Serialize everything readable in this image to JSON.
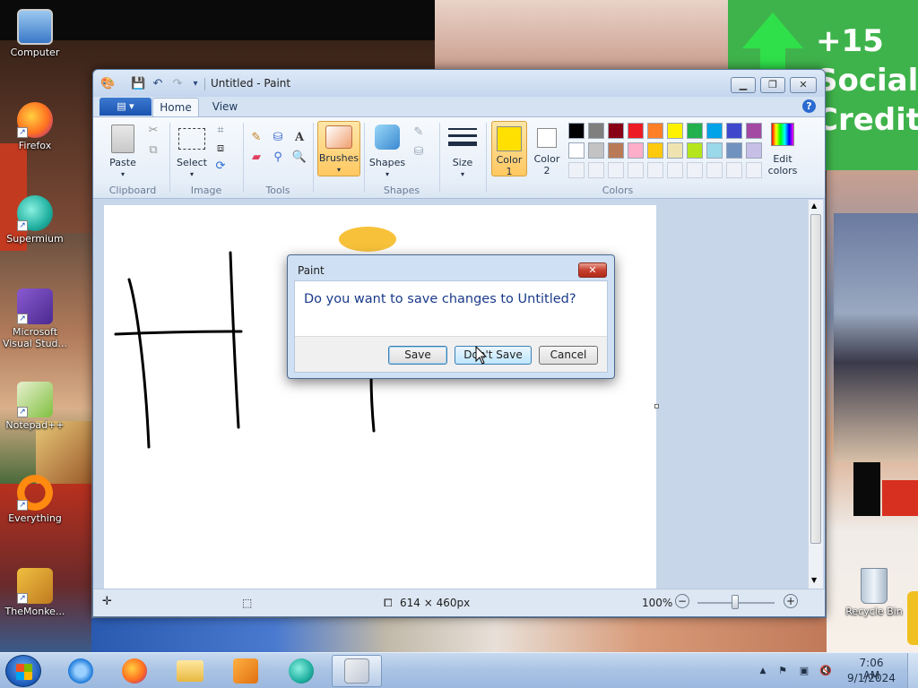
{
  "desktop": {
    "wallpaper_text": "+15\nSocial\nCredit",
    "icons": [
      {
        "label": "Computer"
      },
      {
        "label": "Firefox"
      },
      {
        "label": "Supermium"
      },
      {
        "label": "Microsoft\nVisual Stud..."
      },
      {
        "label": "Notepad++"
      },
      {
        "label": "Everything"
      },
      {
        "label": "TheMonke..."
      },
      {
        "label": "Recycle Bin"
      }
    ]
  },
  "paint": {
    "title": "Untitled - Paint",
    "tabs": [
      {
        "label": "Home"
      },
      {
        "label": "View"
      }
    ],
    "ribbon": {
      "clipboard": {
        "group_label": "Clipboard",
        "paste_label": "Paste"
      },
      "image": {
        "group_label": "Image",
        "select_label": "Select"
      },
      "tools": {
        "group_label": "Tools"
      },
      "brushes": {
        "label": "Brushes"
      },
      "shapes": {
        "group_label": "Shapes",
        "shapes_label": "Shapes"
      },
      "size": {
        "label": "Size"
      },
      "colors": {
        "group_label": "Colors",
        "color1_label": "Color\n1",
        "color2_label": "Color\n2",
        "edit_label": "Edit\ncolors",
        "color1": "#FFE000",
        "color2": "#FFFFFF",
        "palette_row1": [
          "#000000",
          "#7F7F7F",
          "#880015",
          "#ED1C24",
          "#FF7F27",
          "#FFF200",
          "#22B14C",
          "#00A2E8",
          "#3F48CC",
          "#A349A4"
        ],
        "palette_row2": [
          "#FFFFFF",
          "#C3C3C3",
          "#B97A57",
          "#FFAEC9",
          "#FFC90E",
          "#EFE4B0",
          "#B5E61D",
          "#99D9EA",
          "#7092BE",
          "#C8BFE7"
        ]
      }
    },
    "status": {
      "dimensions": "614 × 460px",
      "zoom": "100%"
    }
  },
  "dialog": {
    "title": "Paint",
    "message": "Do you want to save changes to Untitled?",
    "buttons": {
      "save": "Save",
      "dont_save": "Don't Save",
      "cancel": "Cancel"
    }
  },
  "taskbar": {
    "clock_time": "7:06 AM",
    "clock_date": "9/1/2024"
  }
}
